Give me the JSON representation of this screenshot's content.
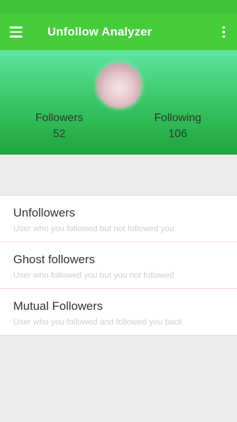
{
  "app_bar": {
    "title": "Unfollow Analyzer",
    "menu_icon": "hamburger-menu-icon",
    "overflow_icon": "more-vert-icon",
    "color": "#47cd3c"
  },
  "profile": {
    "avatar": "profile-avatar",
    "followers_label": "Followers",
    "followers_count": "52",
    "following_label": "Following",
    "following_count": "106"
  },
  "list": [
    {
      "title": "Unfollowers",
      "subtitle": "User who you followed but not followed you"
    },
    {
      "title": "Ghost followers",
      "subtitle": "User who followed you but you not followed"
    },
    {
      "title": "Mutual Followers",
      "subtitle": "User who you followed and followed you back"
    }
  ]
}
